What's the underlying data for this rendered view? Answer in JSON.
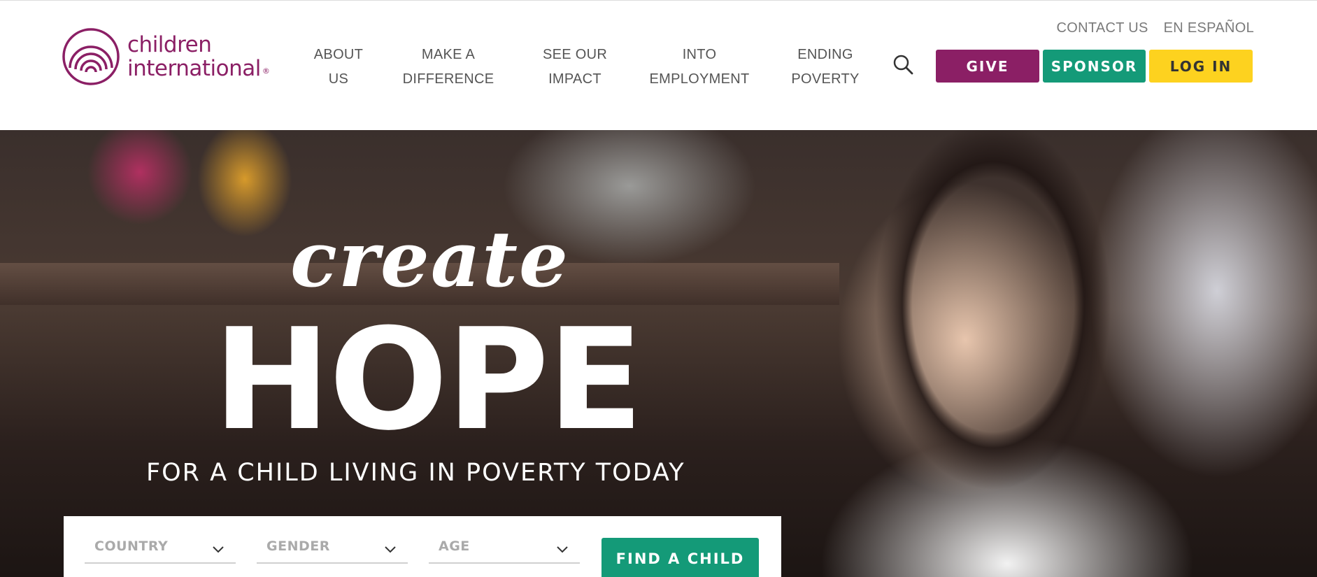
{
  "brand": {
    "logo_line1": "children",
    "logo_line2": "international",
    "logo_mark": "®",
    "color_primary": "#8b1f65",
    "color_green": "#149a78",
    "color_yellow": "#fdd21f"
  },
  "utility_links": [
    {
      "label": "CONTACT US"
    },
    {
      "label": "EN ESPAÑOL"
    }
  ],
  "nav": [
    {
      "line1": "ABOUT",
      "line2": "US"
    },
    {
      "line1": "MAKE A",
      "line2": "DIFFERENCE"
    },
    {
      "line1": "SEE OUR",
      "line2": "IMPACT"
    },
    {
      "line1": "INTO",
      "line2": "EMPLOYMENT"
    },
    {
      "line1": "ENDING",
      "line2": "POVERTY"
    }
  ],
  "search_icon": "search-icon",
  "cta": {
    "give": "GIVE",
    "sponsor": "SPONSOR",
    "login": "LOG IN"
  },
  "hero": {
    "script_word": "create",
    "headline": "HOPE",
    "subline": "FOR A CHILD LIVING IN POVERTY TODAY"
  },
  "finder": {
    "country": "COUNTRY",
    "gender": "GENDER",
    "age": "AGE",
    "button": "FIND A CHILD",
    "dropdown_icon": "chevron-down-icon"
  }
}
